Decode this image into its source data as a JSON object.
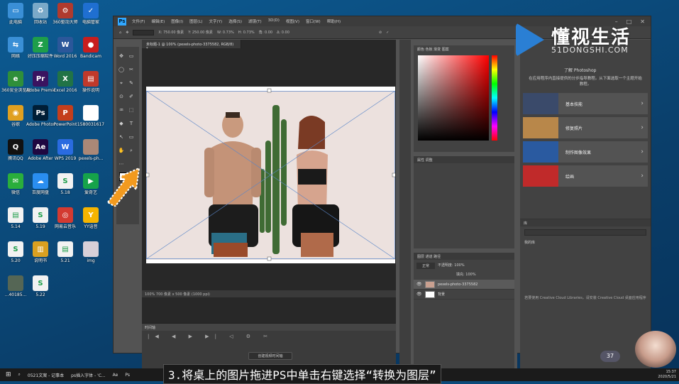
{
  "desktop_icons": [
    {
      "label": "此电脑",
      "color": "#3a8fd6",
      "glyph": "▭"
    },
    {
      "label": "回收站",
      "color": "#7aa9c8",
      "glyph": "♻"
    },
    {
      "label": "360驱动大师",
      "color": "#b03a2e",
      "glyph": "⚙"
    },
    {
      "label": "电脑管家",
      "color": "#1f6fd1",
      "glyph": "✓"
    },
    {
      "label": "网络",
      "color": "#3a8fd6",
      "glyph": "⇆"
    },
    {
      "label": "好压压缩软件",
      "color": "#1e9e4a",
      "glyph": "Z"
    },
    {
      "label": "Word 2016",
      "color": "#2b579a",
      "glyph": "W"
    },
    {
      "label": "Bandicam",
      "color": "#c81e1e",
      "glyph": "●"
    },
    {
      "label": "360安全浏览器",
      "color": "#2f8f3a",
      "glyph": "e"
    },
    {
      "label": "Adobe Premie",
      "color": "#3a1460",
      "glyph": "Pr"
    },
    {
      "label": "Excel 2016",
      "color": "#217346",
      "glyph": "X"
    },
    {
      "label": "操作说明",
      "color": "#c0392b",
      "glyph": "▤"
    },
    {
      "label": "谷歌",
      "color": "#e0a020",
      "glyph": "◉"
    },
    {
      "label": "Adobe Photosh",
      "color": "#001e36",
      "glyph": "Ps"
    },
    {
      "label": "PowerPoint",
      "color": "#c43e1c",
      "glyph": "P"
    },
    {
      "label": "1580031617",
      "color": "#ffffff",
      "glyph": ""
    },
    {
      "label": "腾讯QQ",
      "color": "#111111",
      "glyph": "Q"
    },
    {
      "label": "Adobe After",
      "color": "#1f0740",
      "glyph": "Ae"
    },
    {
      "label": "WPS 2019",
      "color": "#2a6be0",
      "glyph": "W"
    },
    {
      "label": "pexels-ph...",
      "color": "#aa8877",
      "glyph": ""
    },
    {
      "label": "微信",
      "color": "#2aae3c",
      "glyph": "✉"
    },
    {
      "label": "百度网盘",
      "color": "#2a8ef0",
      "glyph": "☁"
    },
    {
      "label": "5.18",
      "color": "#f2f2f2",
      "glyph": "S"
    },
    {
      "label": "爱奇艺",
      "color": "#16a34a",
      "glyph": "▶"
    },
    {
      "label": "5.14",
      "color": "#f2f2f2",
      "glyph": "▤"
    },
    {
      "label": "5.19",
      "color": "#f2f2f2",
      "glyph": "S"
    },
    {
      "label": "网易云音乐",
      "color": "#d33a31",
      "glyph": "◎"
    },
    {
      "label": "YY语音",
      "color": "#f5b400",
      "glyph": "Y"
    },
    {
      "label": "5.20",
      "color": "#f2f2f2",
      "glyph": "S"
    },
    {
      "label": "说明书",
      "color": "#d9a020",
      "glyph": "▥"
    },
    {
      "label": "5.21",
      "color": "#f2f2f2",
      "glyph": "▤"
    },
    {
      "label": "img",
      "color": "#d8d0d8",
      "glyph": ""
    },
    {
      "label": "...40185...",
      "color": "#556655",
      "glyph": ""
    },
    {
      "label": "5.22",
      "color": "#f2f2f2",
      "glyph": "S"
    }
  ],
  "ps": {
    "menu": [
      "文件(F)",
      "编辑(E)",
      "图像(I)",
      "图层(L)",
      "文字(Y)",
      "选择(S)",
      "滤镜(T)",
      "3D(D)",
      "视图(V)",
      "窗口(W)",
      "帮助(H)"
    ],
    "options": [
      "X: 750.00 像素",
      "Y: 250.00 像素",
      "W: 0.73%",
      "H: 0.73%",
      "角: 0.00",
      "Δ: 0.00"
    ],
    "doc_tab": "未标题-1 @ 100% (pexels-photo-3375582, RGB/8) *",
    "doc_status": "100%    700 像素 x 500 像素 (1000 ppi)",
    "timeline_title": "时间轴",
    "timeline_button": "创建视频时间轴",
    "color_tabs": "颜色   色板   渐变   图案",
    "adjust_tabs": "属性   调整",
    "layers_tabs": "图层   通道   路径",
    "layer_kind": "正常",
    "opacity": "不透明度: 100%",
    "fill": "填充: 100%",
    "layers": [
      {
        "name": "pexels-photo-3375582",
        "selected": true
      },
      {
        "name": "背景",
        "selected": false
      }
    ]
  },
  "learn": {
    "title": "了解 Photoshop",
    "desc": "在应用程序内直接提供的分步指导教程。从下面选取一个主题开始教程。",
    "cards": [
      {
        "label": "基本技能",
        "color": "#3a4a6a"
      },
      {
        "label": "修复照片",
        "color": "#b8874a"
      },
      {
        "label": "制作图像效果",
        "color": "#2a5aa0"
      },
      {
        "label": "绘画",
        "color": "#c02a2a"
      }
    ],
    "lib_tab": "库",
    "lib_select": "我的库",
    "cc_msg": "若要使用 Creative Cloud Libraries，请安装 Creative Cloud 桌面应用程序"
  },
  "watermark": {
    "zh": "懂视生活",
    "en": "51DONGSHI.COM"
  },
  "subtitle": "3.将桌上的图片拖进PS中单击右键选择“转换为图层”",
  "taskbar": [
    "0521文案 - 记事本",
    "ps插入字体 - 'C...",
    "Ae",
    "Ps"
  ],
  "badge": "37",
  "clock": {
    "time": "15:37",
    "date": "2020/5/21"
  }
}
